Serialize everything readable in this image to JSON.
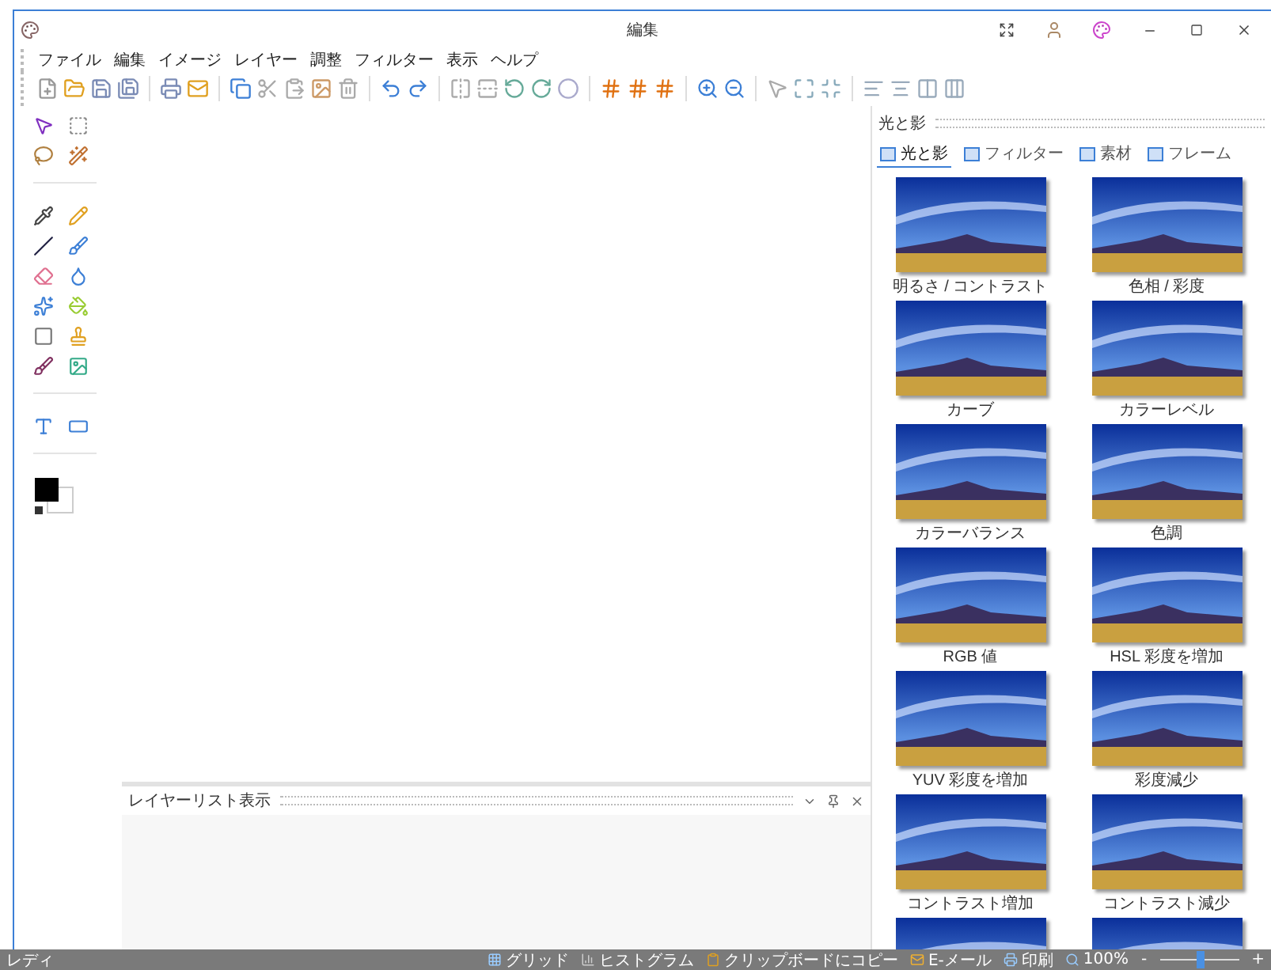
{
  "window": {
    "title": "編集"
  },
  "menu": [
    "ファイル",
    "編集",
    "イメージ",
    "レイヤー",
    "調整",
    "フィルター",
    "表示",
    "ヘルプ"
  ],
  "effects_panel": {
    "title": "光と影",
    "tabs": [
      {
        "label": "光と影",
        "selected": true
      },
      {
        "label": "フィルター",
        "selected": false
      },
      {
        "label": "素材",
        "selected": false
      },
      {
        "label": "フレーム",
        "selected": false
      }
    ],
    "thumbnails": [
      {
        "kind": "effect",
        "label": "明るさ / コントラスト"
      },
      {
        "kind": "effect",
        "label": "色相 / 彩度"
      },
      {
        "kind": "effect",
        "label": "カーブ"
      },
      {
        "kind": "effect",
        "label": "カラーレベル"
      },
      {
        "kind": "effect",
        "label": "カラーバランス"
      },
      {
        "kind": "effect",
        "label": "色調"
      },
      {
        "kind": "effect",
        "label": "RGB 値"
      },
      {
        "kind": "effect",
        "label": "HSL 彩度を増加"
      },
      {
        "kind": "effect",
        "label": "YUV 彩度を増加"
      },
      {
        "kind": "effect",
        "label": "彩度減少"
      },
      {
        "kind": "effect",
        "label": "コントラスト増加"
      },
      {
        "kind": "effect",
        "label": "コントラスト減少"
      },
      {
        "kind": "partial"
      },
      {
        "kind": "partial"
      }
    ]
  },
  "layer_panel": {
    "title": "レイヤーリスト表示"
  },
  "status_bar": {
    "status": "レディ",
    "items": [
      {
        "kind": "grid",
        "label": "グリッド"
      },
      {
        "kind": "histogram",
        "label": "ヒストグラム"
      },
      {
        "kind": "clipboard",
        "label": "クリップボードにコピー"
      },
      {
        "kind": "mail",
        "label": "E-メール"
      },
      {
        "kind": "print",
        "label": "印刷"
      },
      {
        "kind": "zoom",
        "label": "100%"
      }
    ],
    "zoom_slider": {
      "minus": "-",
      "plus": "+",
      "level": 0.5
    }
  }
}
